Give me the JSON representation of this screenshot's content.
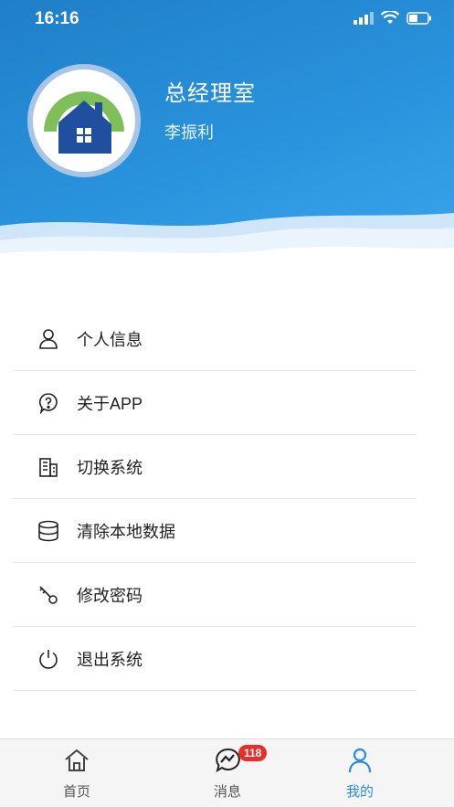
{
  "status_bar": {
    "time": "16:16"
  },
  "profile": {
    "department": "总经理室",
    "name": "李振利"
  },
  "menu": {
    "items": [
      {
        "label": "个人信息",
        "icon": "person-icon"
      },
      {
        "label": "关于APP",
        "icon": "question-icon"
      },
      {
        "label": "切换系统",
        "icon": "building-icon"
      },
      {
        "label": "清除本地数据",
        "icon": "database-icon"
      },
      {
        "label": "修改密码",
        "icon": "key-icon"
      },
      {
        "label": "退出系统",
        "icon": "power-icon"
      }
    ]
  },
  "tabbar": {
    "tabs": [
      {
        "label": "首页",
        "icon": "home-icon",
        "active": false
      },
      {
        "label": "消息",
        "icon": "message-icon",
        "active": false,
        "badge": "118"
      },
      {
        "label": "我的",
        "icon": "profile-icon",
        "active": true
      }
    ]
  },
  "colors": {
    "header_blue": "#2a93dd",
    "accent": "#2a8ce0",
    "badge_red": "#e3302c"
  }
}
